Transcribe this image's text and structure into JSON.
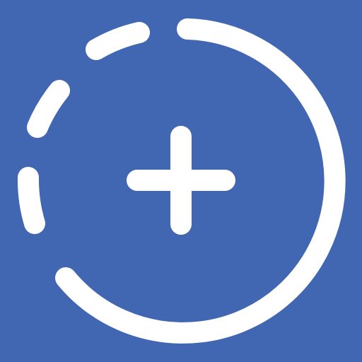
{
  "icon": {
    "name": "add-story-icon",
    "colors": {
      "background": "#4267B2",
      "foreground": "#FFFFFF"
    }
  }
}
